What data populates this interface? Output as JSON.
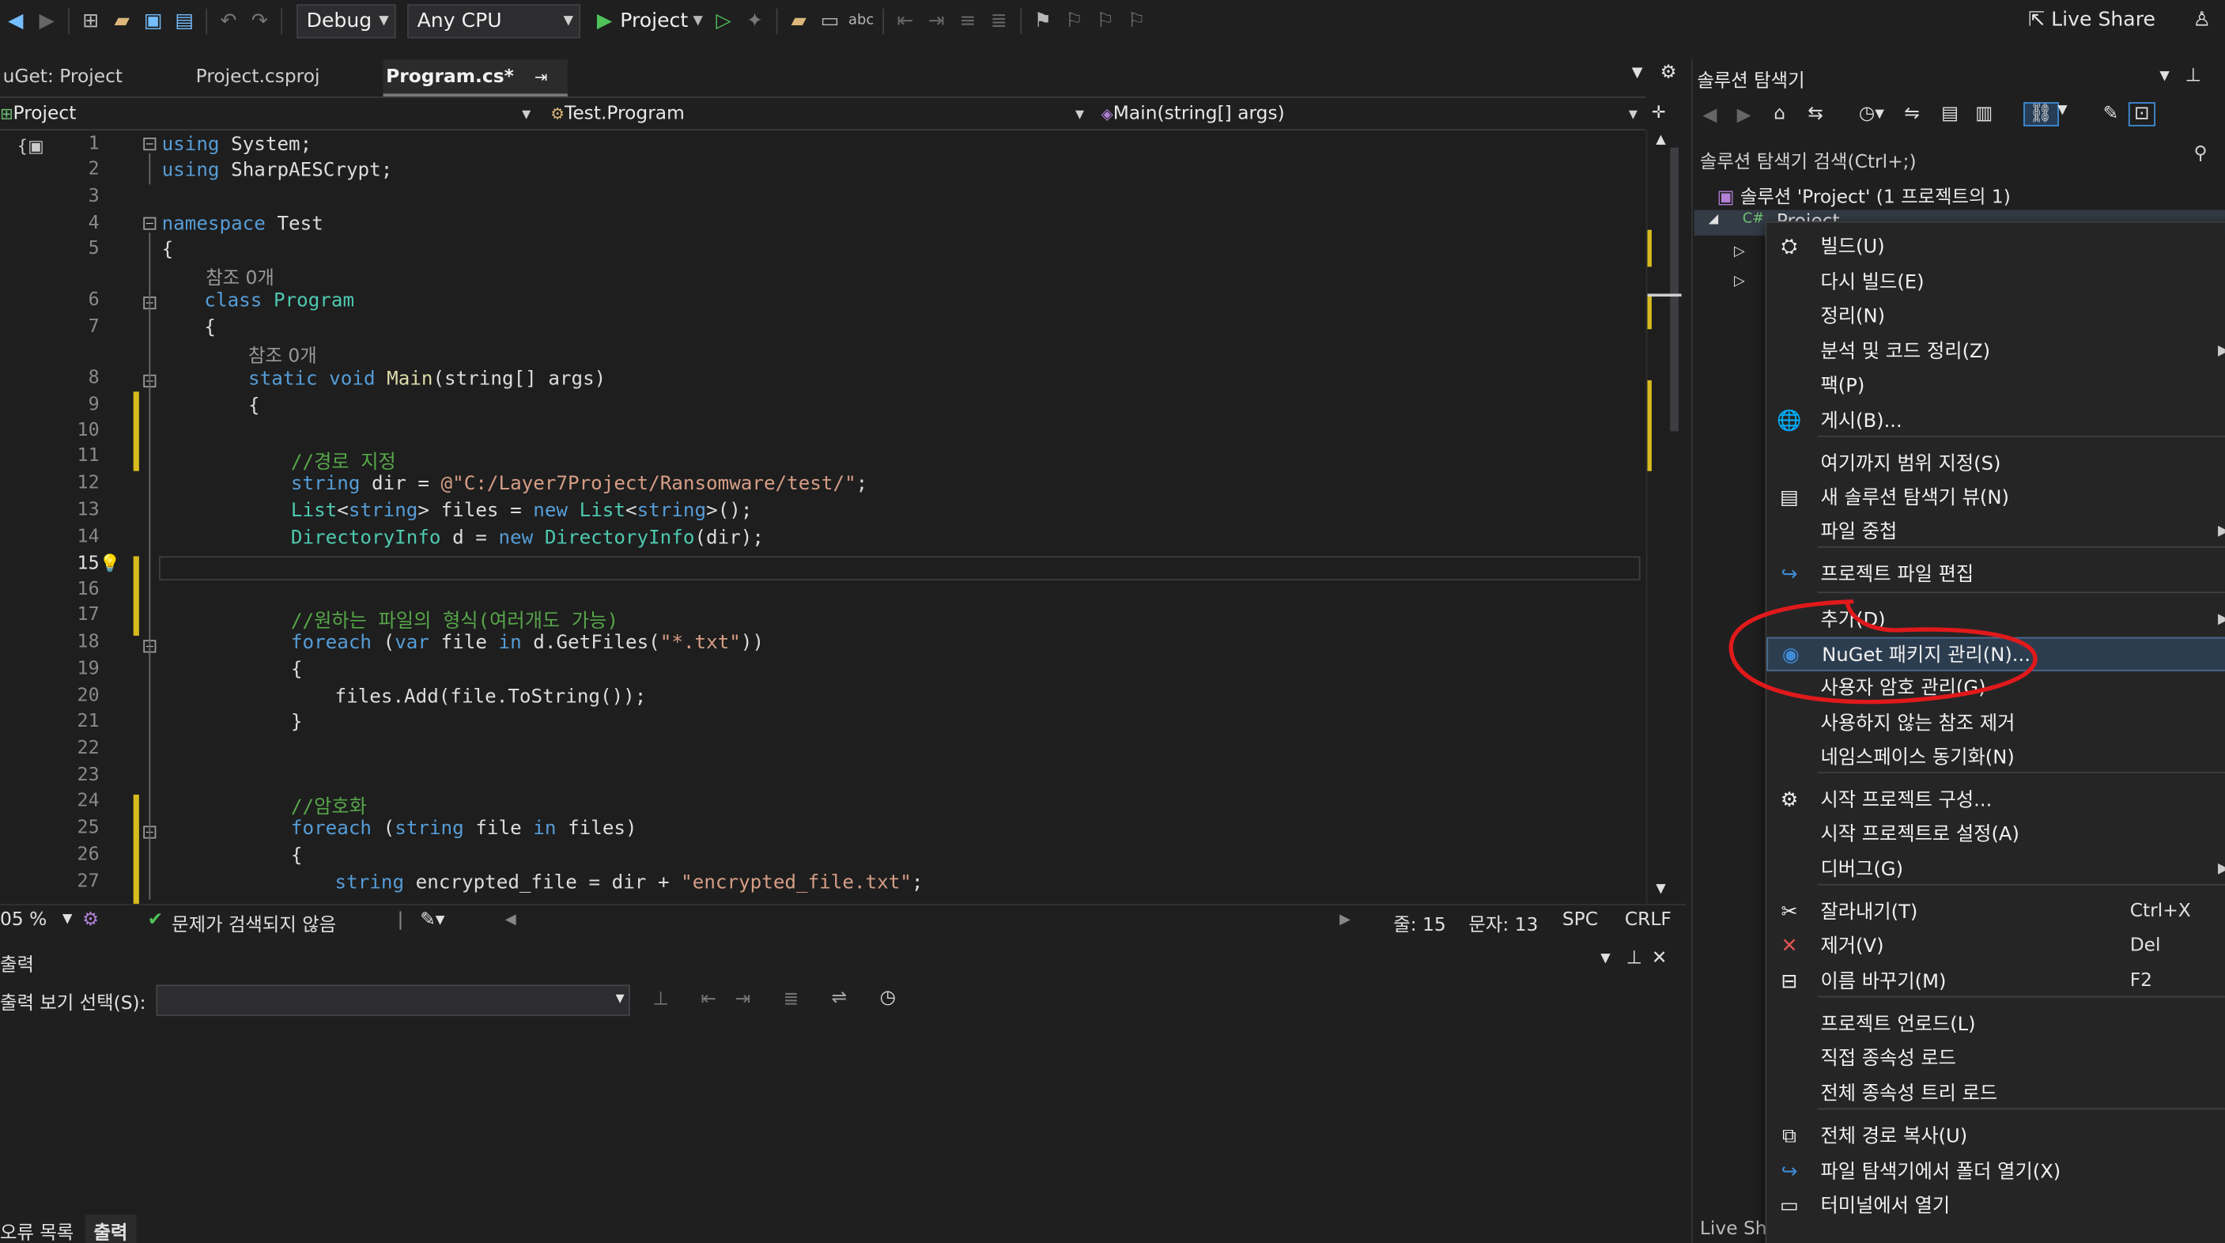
{
  "toolbar": {
    "config": "Debug",
    "platform": "Any CPU",
    "run_label": "Project",
    "live_share": "Live Share"
  },
  "tabs": [
    {
      "label": "uGet: Project"
    },
    {
      "label": "Project.csproj"
    },
    {
      "label": "Program.cs*"
    }
  ],
  "tab_pin": "⇥",
  "nav": {
    "project": "Project",
    "type": "Test.Program",
    "member": "Main(string[] args)"
  },
  "code": {
    "lines": [
      {
        "n": "1"
      },
      {
        "n": "2"
      },
      {
        "n": "3"
      },
      {
        "n": "4"
      },
      {
        "n": "5"
      },
      {
        "n": "6"
      },
      {
        "n": "7"
      },
      {
        "n": "8"
      },
      {
        "n": "9"
      },
      {
        "n": "10"
      },
      {
        "n": "11"
      },
      {
        "n": "12"
      },
      {
        "n": "13"
      },
      {
        "n": "14"
      },
      {
        "n": "15"
      },
      {
        "n": "16"
      },
      {
        "n": "17"
      },
      {
        "n": "18"
      },
      {
        "n": "19"
      },
      {
        "n": "20"
      },
      {
        "n": "21"
      },
      {
        "n": "22"
      },
      {
        "n": "23"
      },
      {
        "n": "24"
      },
      {
        "n": "25"
      },
      {
        "n": "26"
      },
      {
        "n": "27"
      }
    ],
    "refs_zero": "참조 0개",
    "text": {
      "using1_kw": "using",
      "using1": " System;",
      "using2_kw": "using",
      "using2": " SharpAESCrypt;",
      "ns_kw": "namespace",
      "ns": " Test",
      "brace_open": "{",
      "brace_close": "}",
      "class_kw": "class",
      "class_name": " Program",
      "main_static": "static",
      "main_void": " void",
      "main_name": " Main",
      "main_args": "(string[] args)",
      "c11": "//경로 지정",
      "l12_kw": "string",
      "l12_a": " dir = ",
      "l12_str": "@\"C:/Layer7Project/Ransomware/test/\"",
      "l12_end": ";",
      "l13_ty": "List",
      "l13_a": "<",
      "l13_kw": "string",
      "l13_b": "> files = ",
      "l13_new": "new",
      "l13_ty2": " List",
      "l13_c": "<",
      "l13_kw2": "string",
      "l13_d": ">();",
      "l14_ty": "DirectoryInfo",
      "l14_a": " d = ",
      "l14_new": "new",
      "l14_ty2": " DirectoryInfo",
      "l14_b": "(dir);",
      "c17": "//원하는 파일의 형식(여러개도 가능)",
      "l18_kw": "foreach",
      "l18_a": " (",
      "l18_var": "var",
      "l18_b": " file ",
      "l18_in": "in",
      "l18_c": " d.GetFiles(",
      "l18_str": "\"*.txt\"",
      "l18_d": "))",
      "l20": "files.Add(file.ToString());",
      "c24": "//암호화",
      "l25_kw": "foreach",
      "l25_a": " (",
      "l25_str": "string",
      "l25_b": " file ",
      "l25_in": "in",
      "l25_c": " files)",
      "l27_kw": "string",
      "l27_a": " encrypted_file = dir + ",
      "l27_str": "\"encrypted_file.txt\"",
      "l27_end": ";"
    }
  },
  "status": {
    "zoom": "05 %",
    "issues": "문제가 검색되지 않음",
    "line": "줄: 15",
    "col": "문자: 13",
    "spc": "SPC",
    "crlf": "CRLF"
  },
  "output": {
    "title": "출력",
    "source_label": "출력 보기 선택(S):",
    "source_value": ""
  },
  "bottom_tabs": [
    {
      "label": "오류 목록"
    },
    {
      "label": "출력"
    }
  ],
  "solution_explorer": {
    "title": "솔루션 탐색기",
    "search_placeholder": "솔루션 탐색기 검색(Ctrl+;)",
    "solution_label": "솔루션 'Project' (1 프로젝트의 1)",
    "project_label": "Project",
    "live_share_cut": "Live Sh"
  },
  "context_menu": {
    "items": [
      {
        "label": "빌드(U)",
        "icon": "build-icon"
      },
      {
        "label": "다시 빌드(E)"
      },
      {
        "label": "정리(N)"
      },
      {
        "label": "분석 및 코드 정리(Z)",
        "sub": true
      },
      {
        "label": "팩(P)"
      },
      {
        "label": "게시(B)...",
        "icon": "globe-icon"
      },
      {
        "label": "여기까지 범위 지정(S)"
      },
      {
        "label": "새 솔루션 탐색기 뷰(N)",
        "icon": "new-view-icon"
      },
      {
        "label": "파일 중첩",
        "sub": true
      },
      {
        "label": "프로젝트 파일 편집",
        "icon": "edit-arrow-icon"
      },
      {
        "label": "추가(D)",
        "sub": true
      },
      {
        "label": "NuGet 패키지 관리(N)...",
        "icon": "nuget-icon",
        "highlight": true
      },
      {
        "label": "사용자 암호 관리(G)"
      },
      {
        "label": "사용하지 않는 참조 제거"
      },
      {
        "label": "네임스페이스 동기화(N)"
      },
      {
        "label": "시작 프로젝트 구성...",
        "icon": "gear-icon"
      },
      {
        "label": "시작 프로젝트로 설정(A)"
      },
      {
        "label": "디버그(G)",
        "sub": true
      },
      {
        "label": "잘라내기(T)",
        "icon": "scissors-icon",
        "shortcut": "Ctrl+X"
      },
      {
        "label": "제거(V)",
        "icon": "delete-x-icon",
        "shortcut": "Del"
      },
      {
        "label": "이름 바꾸기(M)",
        "icon": "rename-icon",
        "shortcut": "F2"
      },
      {
        "label": "프로젝트 언로드(L)"
      },
      {
        "label": "직접 종속성 로드"
      },
      {
        "label": "전체 종속성 트리 로드"
      },
      {
        "label": "전체 경로 복사(U)",
        "icon": "copy-icon"
      },
      {
        "label": "파일 탐색기에서 폴더 열기(X)",
        "icon": "open-folder-arrow-icon"
      },
      {
        "label": "터미널에서 열기",
        "icon": "terminal-icon"
      }
    ]
  },
  "colors": {
    "background": "#1e1e1e",
    "keyword": "#569cd6",
    "type": "#4ec9b0",
    "string": "#d69d85",
    "comment": "#57a64a",
    "annotation_red": "#e0191b",
    "highlight": "#2d3d50"
  }
}
